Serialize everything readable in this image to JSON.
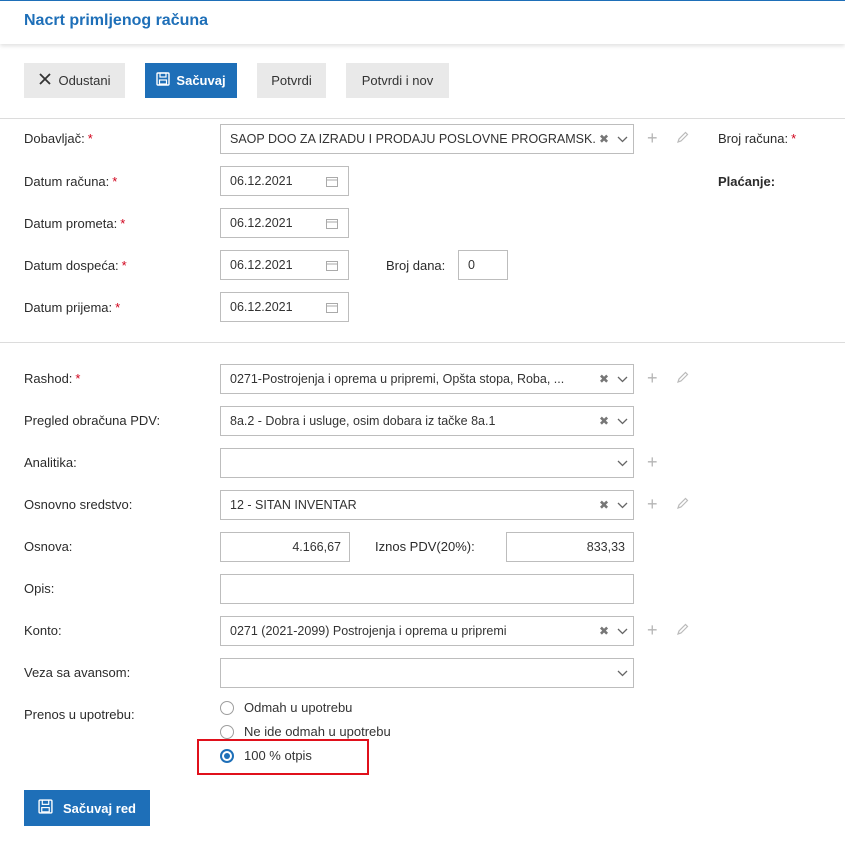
{
  "header": {
    "title": "Nacrt primljenog računa"
  },
  "toolbar": {
    "cancel_label": "Odustani",
    "save_label": "Sačuvaj",
    "confirm_label": "Potvrdi",
    "confirm_new_label": "Potvrdi i nov"
  },
  "header_form": {
    "supplier_label": "Dobavljač:",
    "supplier_value": "SAOP DOO ZA IZRADU I PRODAJU POSLOVNE PROGRAMSK...",
    "invoice_no_label": "Broj računa:",
    "payment_label": "Plaćanje:",
    "invoice_date_label": "Datum računa:",
    "invoice_date_value": "06.12.2021",
    "turnover_date_label": "Datum prometa:",
    "turnover_date_value": "06.12.2021",
    "due_date_label": "Datum dospeća:",
    "due_date_value": "06.12.2021",
    "days_label": "Broj dana:",
    "days_value": "0",
    "receipt_date_label": "Datum prijema:",
    "receipt_date_value": "06.12.2021",
    "required_mark": "*"
  },
  "line_form": {
    "expense_label": "Rashod:",
    "expense_value": "0271-Postrojenja i oprema u pripremi, Opšta stopa, Roba, ...",
    "vat_review_label": "Pregled obračuna PDV:",
    "vat_review_value": "8a.2 - Dobra i usluge, osim dobara iz tačke 8a.1",
    "analytics_label": "Analitika:",
    "analytics_value": "",
    "fixed_asset_label": "Osnovno sredstvo:",
    "fixed_asset_value": "12 - SITAN INVENTAR",
    "base_label": "Osnova:",
    "base_value": "4.166,67",
    "vat_amount_label": "Iznos PDV(20%):",
    "vat_amount_value": "833,33",
    "description_label": "Opis:",
    "description_value": "",
    "account_label": "Konto:",
    "account_value": "0271 (2021-2099) Postrojenja i oprema u pripremi",
    "advance_label": "Veza sa avansom:",
    "advance_value": "",
    "transfer_label": "Prenos u upotrebu:",
    "transfer_options": [
      "Odmah u upotrebu",
      "Ne ide odmah u upotrebu",
      "100 % otpis"
    ],
    "transfer_selected": "100 % otpis",
    "save_row_label": "Sačuvaj red"
  },
  "colors": {
    "accent": "#1e6fb8",
    "required": "#d0021b",
    "highlight": "#e0101b"
  }
}
